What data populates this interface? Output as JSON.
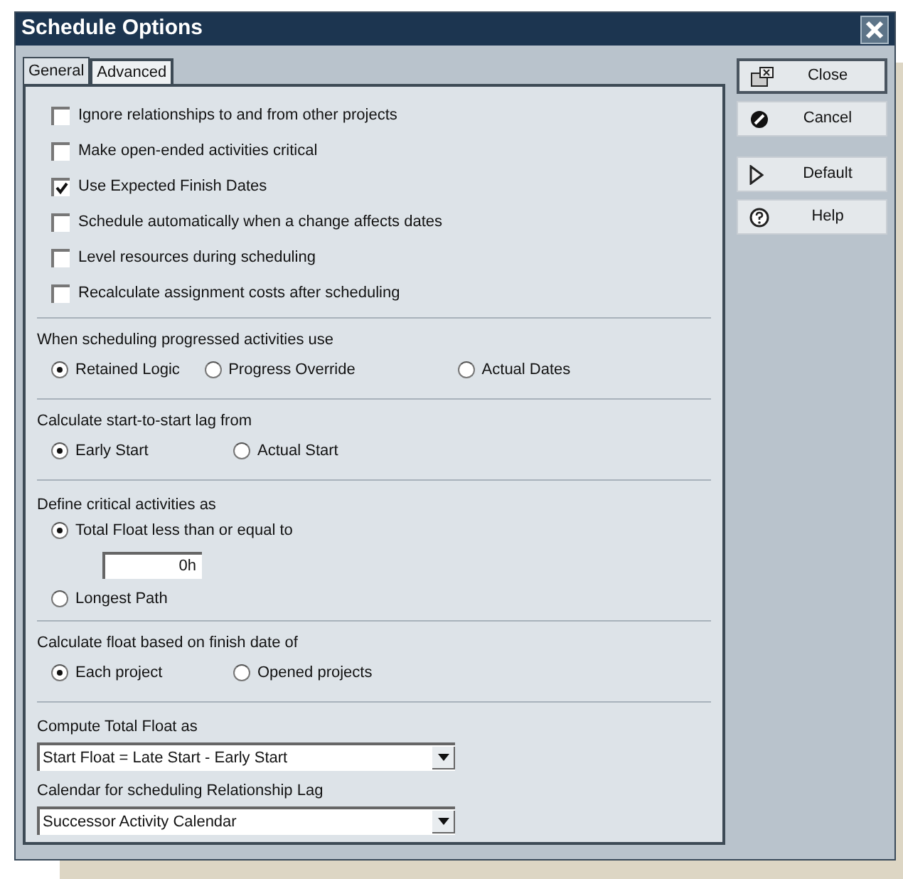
{
  "window": {
    "title": "Schedule Options"
  },
  "tabs": [
    {
      "label": "General",
      "selected": true
    },
    {
      "label": "Advanced",
      "selected": false
    }
  ],
  "sections": [
    {
      "kind": "checkboxes",
      "items": [
        {
          "label": "Ignore relationships to and from other projects",
          "checked": false
        },
        {
          "label": "Make open-ended activities critical",
          "checked": false
        },
        {
          "label": "Use Expected Finish Dates",
          "checked": true
        },
        {
          "label": "Schedule automatically when a change affects dates",
          "checked": false
        },
        {
          "label": "Level resources during scheduling",
          "checked": false
        },
        {
          "label": "Recalculate assignment costs after scheduling",
          "checked": false
        }
      ]
    },
    {
      "kind": "radio_row",
      "label": "When scheduling progressed activities use",
      "options": [
        {
          "label": "Retained Logic",
          "selected": true
        },
        {
          "label": "Progress Override",
          "selected": false
        },
        {
          "label": "Actual Dates",
          "selected": false
        }
      ]
    },
    {
      "kind": "radio_row",
      "label": "Calculate start-to-start lag from",
      "options": [
        {
          "label": "Early Start",
          "selected": true
        },
        {
          "label": "Actual Start",
          "selected": false
        }
      ]
    },
    {
      "kind": "radio_stack",
      "label": "Define critical activities as",
      "options": [
        {
          "label": "Total Float less than or equal to",
          "selected": true,
          "field": "0h"
        },
        {
          "label": "Longest Path",
          "selected": false
        }
      ]
    },
    {
      "kind": "radio_row",
      "label": "Calculate float based on finish date of",
      "options": [
        {
          "label": "Each project",
          "selected": true
        },
        {
          "label": "Opened projects",
          "selected": false
        }
      ]
    },
    {
      "kind": "dropdowns",
      "items": [
        {
          "label": "Compute Total Float as",
          "value": "Start Float = Late Start - Early Start"
        },
        {
          "label": "Calendar for scheduling Relationship Lag",
          "value": "Successor Activity Calendar"
        }
      ]
    }
  ],
  "buttons": [
    {
      "label": "Close",
      "kind": "close",
      "focused": true
    },
    {
      "label": "Cancel",
      "kind": "cancel",
      "focused": false
    },
    {
      "label": "Default",
      "kind": "default",
      "focused": false
    },
    {
      "label": "Help",
      "kind": "help",
      "focused": false
    }
  ]
}
